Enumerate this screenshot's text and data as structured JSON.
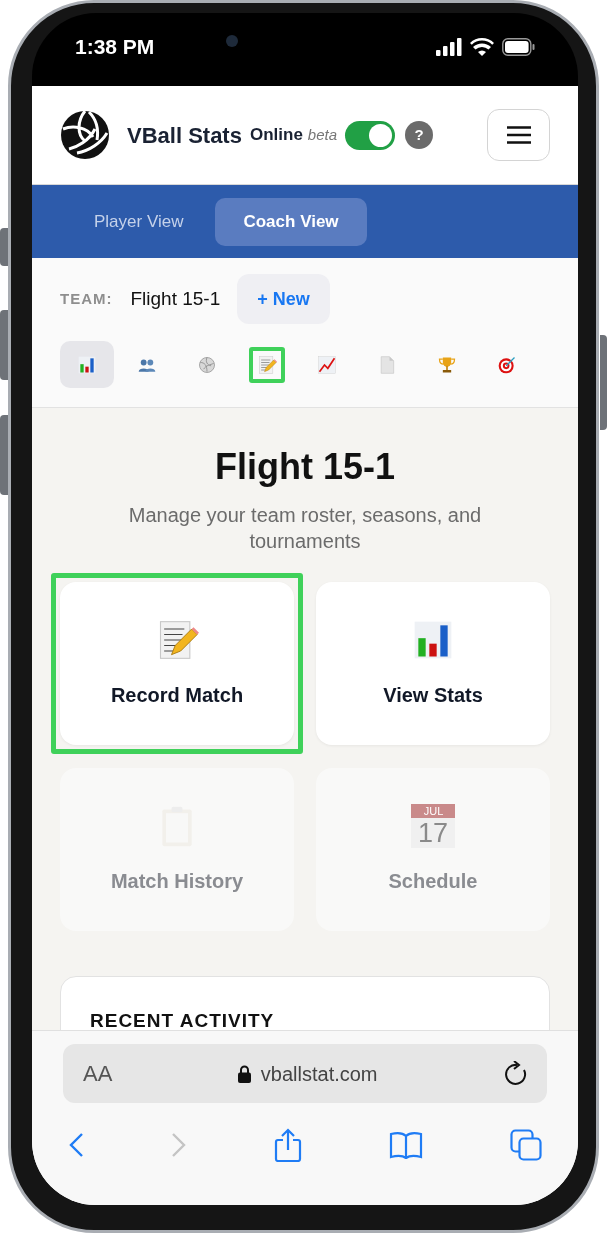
{
  "status_bar": {
    "time": "1:38 PM"
  },
  "header": {
    "app_name": "VBall Stats",
    "mode_label": "Online",
    "mode_tag": "beta",
    "online_toggle": {
      "on": true
    },
    "help_label": "?"
  },
  "tabs": [
    {
      "label": "Player View",
      "selected": false
    },
    {
      "label": "Coach View",
      "selected": true
    }
  ],
  "team": {
    "label": "TEAM:",
    "name": "Flight 15-1",
    "new_button": "+ New"
  },
  "toolbar": [
    {
      "kind": "bar-chart",
      "selected": true,
      "highlighted": false
    },
    {
      "kind": "people",
      "selected": false,
      "highlighted": false
    },
    {
      "kind": "ball",
      "selected": false,
      "highlighted": false
    },
    {
      "kind": "memo",
      "selected": false,
      "highlighted": true
    },
    {
      "kind": "line-chart",
      "selected": false,
      "highlighted": false
    },
    {
      "kind": "page",
      "selected": false,
      "highlighted": false
    },
    {
      "kind": "trophy",
      "selected": false,
      "highlighted": false
    },
    {
      "kind": "target",
      "selected": false,
      "highlighted": false
    }
  ],
  "page": {
    "title": "Flight 15-1",
    "subtitle": "Manage your team roster, seasons, and tournaments"
  },
  "cards": [
    {
      "kind": "memo",
      "label": "Record Match",
      "disabled": false,
      "highlighted": true
    },
    {
      "kind": "bar-chart",
      "label": "View Stats",
      "disabled": false,
      "highlighted": false
    },
    {
      "kind": "clipboard",
      "label": "Match History",
      "disabled": true,
      "highlighted": false
    },
    {
      "kind": "calendar",
      "label": "Schedule",
      "disabled": true,
      "highlighted": false
    }
  ],
  "calendar_icon": {
    "month": "JUL",
    "day": "17"
  },
  "recent_activity": {
    "title": "RECENT ACTIVITY"
  },
  "browser": {
    "text_size": "AA",
    "url": "vballstat.com",
    "back_disabled": false,
    "forward_disabled": true
  }
}
